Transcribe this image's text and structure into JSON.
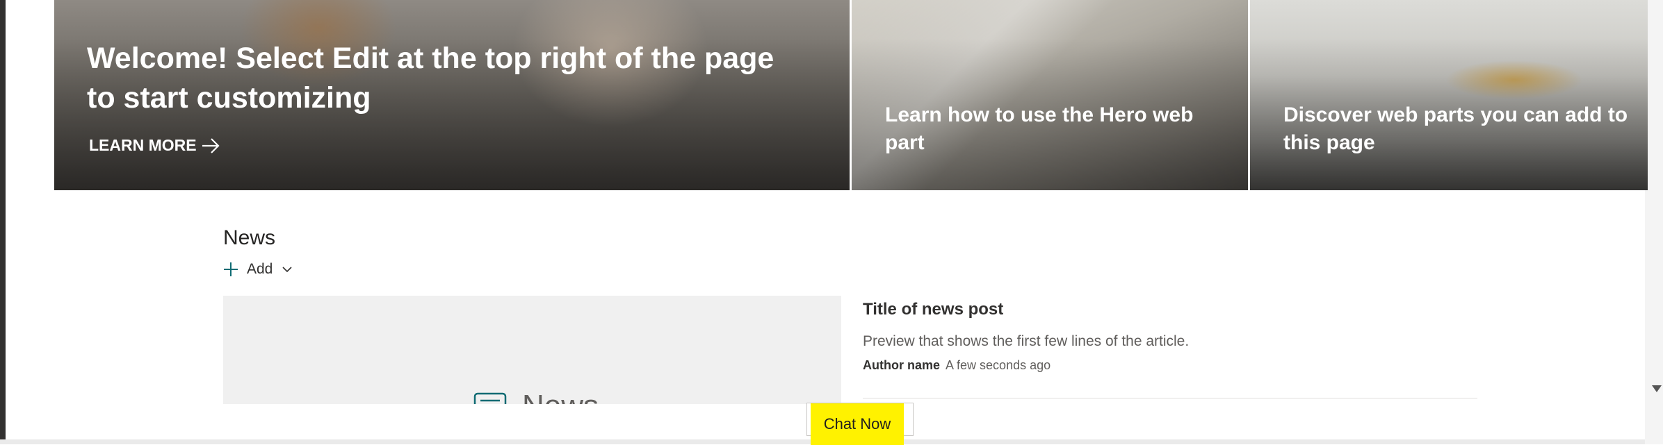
{
  "hero": {
    "main_title": "Welcome! Select Edit at the top right of the page to start customizing",
    "learn_more": "LEARN MORE",
    "tile2_title": "Learn how to use the Hero web part",
    "tile3_title": "Discover web parts you can add to this page"
  },
  "news": {
    "title": "News",
    "add_label": "Add",
    "placeholder_label": "News",
    "post": {
      "title": "Title of news post",
      "preview": "Preview that shows the first few lines of the article.",
      "author": "Author name",
      "time": "A few seconds ago"
    }
  },
  "chat": {
    "label": "Chat Now",
    "highlight_color": "#fff200"
  },
  "icons": {
    "learn_more": "arrow-right-icon",
    "add": "plus-icon",
    "add_menu": "chevron-down-icon",
    "placeholder": "news-icon",
    "scroll": "scroll-down-arrow-icon"
  }
}
